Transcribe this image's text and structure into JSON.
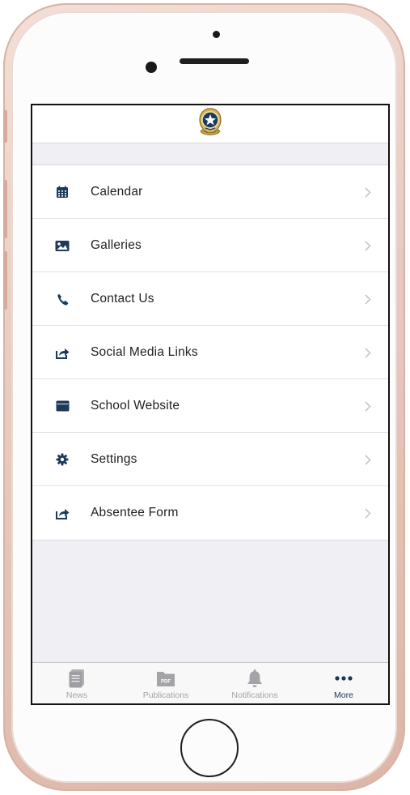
{
  "theme": {
    "icon_color": "#1b3a5c",
    "tab_inactive_color": "#a4a4a8",
    "tab_active_color": "#1d3557"
  },
  "header": {
    "logo_icon": "school-crest-logo"
  },
  "menu": {
    "items": [
      {
        "label": "Calendar",
        "icon": "calendar-icon"
      },
      {
        "label": "Galleries",
        "icon": "gallery-icon"
      },
      {
        "label": "Contact Us",
        "icon": "phone-icon"
      },
      {
        "label": "Social Media Links",
        "icon": "share-icon"
      },
      {
        "label": "School Website",
        "icon": "browser-window-icon"
      },
      {
        "label": "Settings",
        "icon": "gear-icon"
      },
      {
        "label": "Absentee Form",
        "icon": "share-icon"
      }
    ]
  },
  "tabbar": {
    "tabs": [
      {
        "label": "News",
        "icon": "newspaper-icon",
        "active": false
      },
      {
        "label": "Publications",
        "icon": "pdf-folder-icon",
        "active": false
      },
      {
        "label": "Notifications",
        "icon": "bell-icon",
        "active": false
      },
      {
        "label": "More",
        "icon": "more-dots-icon",
        "active": true
      }
    ]
  }
}
